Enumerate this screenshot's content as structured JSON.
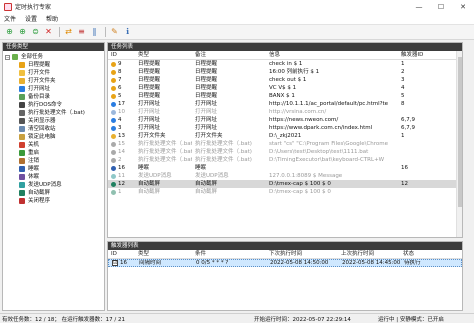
{
  "window": {
    "title": "定时执行专家",
    "minimize": "—",
    "maximize": "☐",
    "close": "✕"
  },
  "menu": [
    "文件",
    "设置",
    "帮助"
  ],
  "left_panel": {
    "header": "任务类型",
    "root": "全部任务",
    "items": [
      {
        "label": "日程提醒",
        "color": "#e8a317"
      },
      {
        "label": "打开文件",
        "color": "#f0c040"
      },
      {
        "label": "打开文件夹",
        "color": "#e8b030"
      },
      {
        "label": "打开网址",
        "color": "#2a7de1"
      },
      {
        "label": "备份目录",
        "color": "#5aa05a"
      },
      {
        "label": "执行DOS命令",
        "color": "#444444"
      },
      {
        "label": "执行批处理文件（.bat)",
        "color": "#666666"
      },
      {
        "label": "关闭显示器",
        "color": "#555555"
      },
      {
        "label": "清空回收站",
        "color": "#6a8ab0"
      },
      {
        "label": "锁定此电脑",
        "color": "#c8a040"
      },
      {
        "label": "关机",
        "color": "#d04030"
      },
      {
        "label": "重启",
        "color": "#3a9a3a"
      },
      {
        "label": "注销",
        "color": "#b07030"
      },
      {
        "label": "睡眠",
        "color": "#3060b0"
      },
      {
        "label": "休眠",
        "color": "#7050a0"
      },
      {
        "label": "发送UDP消息",
        "color": "#30a0a0"
      },
      {
        "label": "自动截屏",
        "color": "#208060"
      },
      {
        "label": "关闭程序",
        "color": "#c03030"
      }
    ]
  },
  "task_list": {
    "header": "任务列表",
    "columns": [
      "ID",
      "类型",
      "备注",
      "信息",
      "触发器ID"
    ],
    "rows": [
      {
        "id": "9",
        "type": "日程提醒",
        "note": "日程提醒",
        "info": "check in $ 1",
        "trig": "1",
        "state": "on",
        "ic": "#e8a317"
      },
      {
        "id": "8",
        "type": "日程提醒",
        "note": "日程提醒",
        "info": "16:00 列前执行 $ 1",
        "trig": "2",
        "state": "on",
        "ic": "#e8a317"
      },
      {
        "id": "7",
        "type": "日程提醒",
        "note": "日程提醒",
        "info": "check out $ 1",
        "trig": "3",
        "state": "on",
        "ic": "#e8a317"
      },
      {
        "id": "6",
        "type": "日程提醒",
        "note": "日程提醒",
        "info": "VC V$ $ 1",
        "trig": "4",
        "state": "on",
        "ic": "#e8a317"
      },
      {
        "id": "5",
        "type": "日程提醒",
        "note": "日程提醒",
        "info": "BANX $ 1",
        "trig": "5",
        "state": "on",
        "ic": "#e8a317"
      },
      {
        "id": "17",
        "type": "打开网址",
        "note": "打开网址",
        "info": "http://10.1.1.1/ac_portal/default/pc.html?te",
        "trig": "8",
        "state": "on",
        "ic": "#2a7de1"
      },
      {
        "id": "10",
        "type": "打开网址",
        "note": "打开网址",
        "info": "http://vrsina.com.cn/",
        "trig": "",
        "state": "off",
        "ic": "#9cb8dc"
      },
      {
        "id": "4",
        "type": "打开网址",
        "note": "打开网址",
        "info": "https://news.nweon.com/",
        "trig": "6,7,9",
        "state": "on",
        "ic": "#2a7de1"
      },
      {
        "id": "3",
        "type": "打开网址",
        "note": "打开网址",
        "info": "https://www.dpark.com.cn/index.html",
        "trig": "6,7,9",
        "state": "on",
        "ic": "#2a7de1"
      },
      {
        "id": "13",
        "type": "打开文件夹",
        "note": "打开文件夹",
        "info": "D:\\_zkj2021",
        "trig": "1",
        "state": "on",
        "ic": "#e8b030"
      },
      {
        "id": "15",
        "type": "执行批处理文件（.bat)",
        "note": "执行批处理文件（.bat)",
        "info": "start \"cs\" \"C:\\Program Files\\Google\\Chrome",
        "trig": "",
        "state": "off",
        "ic": "#aaaaaa"
      },
      {
        "id": "14",
        "type": "执行批处理文件（.bat)",
        "note": "执行批处理文件（.bat)",
        "info": "D:\\Users\\test\\Desktop\\test\\1111.bat",
        "trig": "",
        "state": "off",
        "ic": "#aaaaaa"
      },
      {
        "id": "2",
        "type": "执行批处理文件（.bat)",
        "note": "执行批处理文件（.bat)",
        "info": "D:\\TimingExecutor\\bat\\keyboard-CTRL+W",
        "trig": "",
        "state": "off",
        "ic": "#aaaaaa"
      },
      {
        "id": "16",
        "type": "睡眠",
        "note": "睡眠",
        "info": "",
        "trig": "16",
        "state": "on",
        "ic": "#3060b0"
      },
      {
        "id": "11",
        "type": "发送UDP消息",
        "note": "发送UDP消息",
        "info": "127.0.0.1:8089 $ Message",
        "trig": "",
        "state": "off",
        "ic": "#8fc8c8"
      },
      {
        "id": "12",
        "type": "自动截屏",
        "note": "自动截屏",
        "info": "D:\\tmex-cap $ 100 $ 0",
        "trig": "12",
        "state": "selected",
        "ic": "#208060"
      },
      {
        "id": "1",
        "type": "自动截屏",
        "note": "自动截屏",
        "info": "D:\\tmex-cap $ 100 $ 0",
        "trig": "",
        "state": "off",
        "ic": "#90c0b0"
      }
    ]
  },
  "trigger_list": {
    "header": "触发器列表",
    "columns": [
      "ID",
      "类型",
      "条件",
      "下次执行时间",
      "上次执行时间",
      "状态"
    ],
    "rows": [
      {
        "id": "16",
        "type": "间隔时间",
        "cond": "0 0/5 * * * ?",
        "next": "2022-05-08 14:50:00",
        "last": "2022-05-08 14:45:00",
        "status": "待执行",
        "checked": "☑"
      }
    ]
  },
  "status": {
    "left": "有效任务数：12 / 18；  在运行触发器数：17 / 21",
    "mid": "开始运行时间：2022-05-07 22:29:14",
    "right": "运行中  |  安静模式：已开启"
  }
}
